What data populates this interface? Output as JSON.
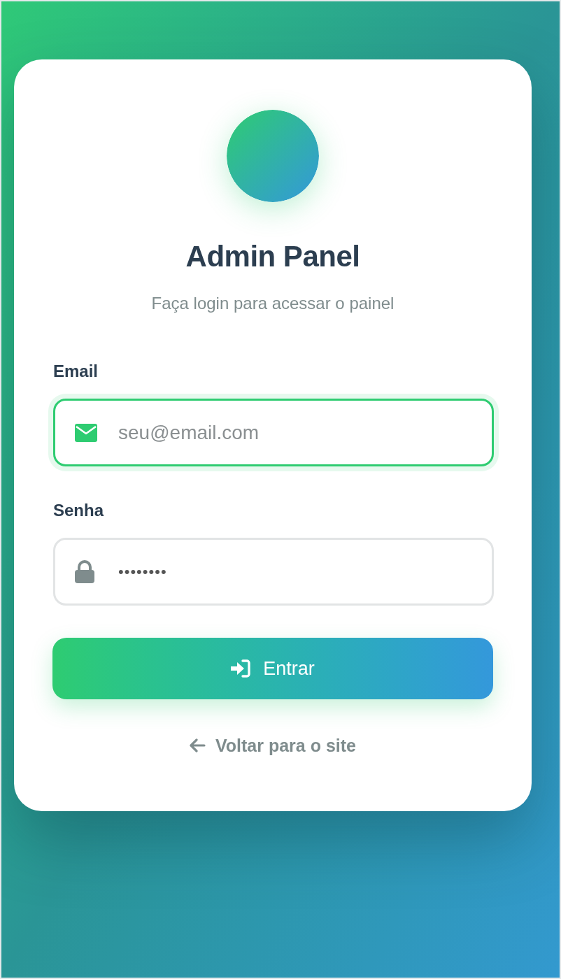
{
  "header": {
    "title": "Admin Panel",
    "subtitle": "Faça login para acessar o painel"
  },
  "form": {
    "fields": [
      {
        "kind": "email",
        "label": "Email",
        "placeholder": "seu@email.com",
        "focused": true
      },
      {
        "kind": "password",
        "label": "Senha",
        "value": "••••••••",
        "focused": false
      }
    ],
    "submit": {
      "label": "Entrar"
    }
  },
  "back_link": {
    "label": "Voltar para o site"
  }
}
